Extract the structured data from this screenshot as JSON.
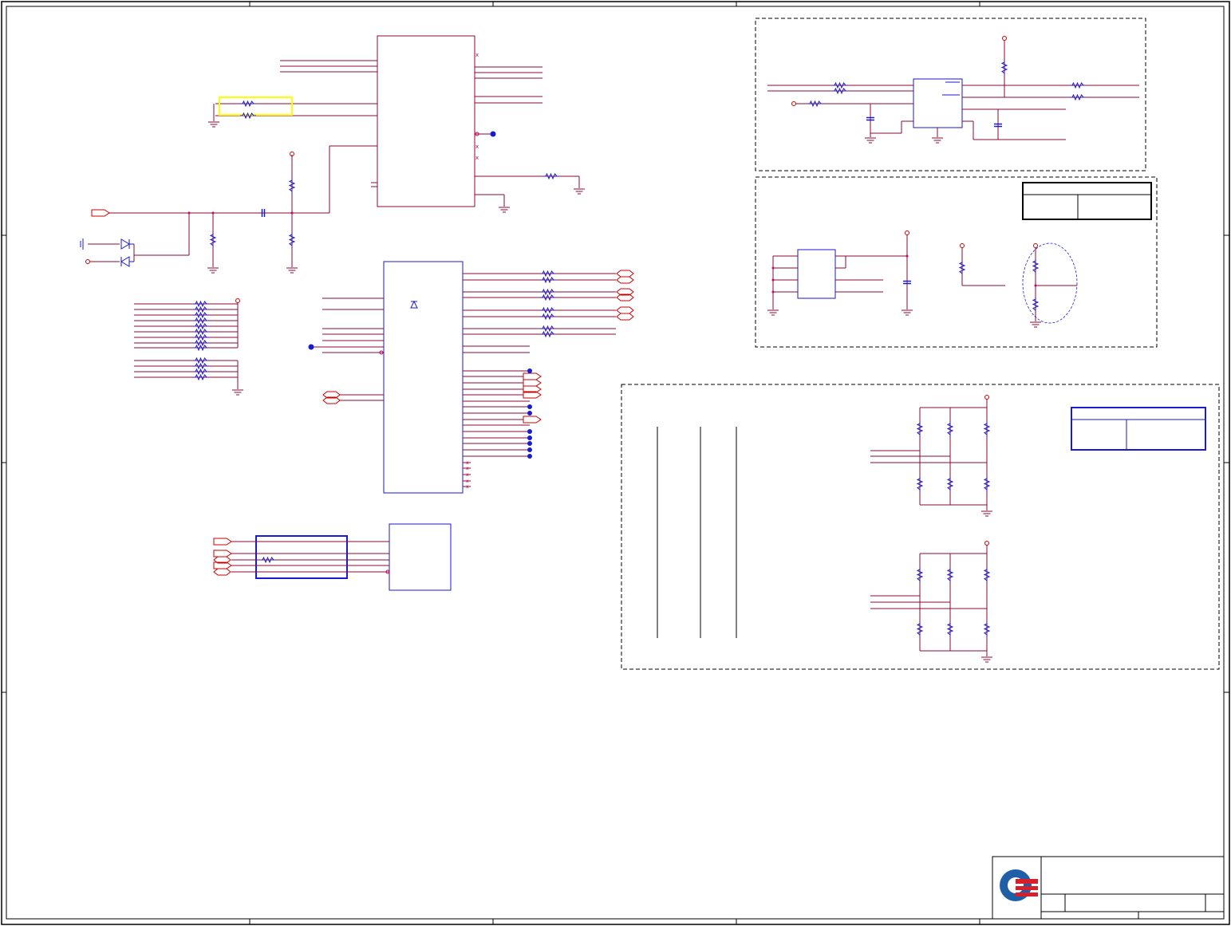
{
  "colors": {
    "frame": "#000000",
    "wire": "#8b0a30",
    "component": "#1a1ad0",
    "pin": "#cc0066",
    "power": "#cc0000",
    "highlight": "#ffff00",
    "logo_blue": "#1f5fa8",
    "logo_red": "#d61f2a"
  },
  "icons": {
    "logo": "company-logo",
    "ground": "ground-symbol",
    "resistor": "resistor-symbol",
    "capacitor": "capacitor-symbol",
    "diode": "diode-symbol",
    "connector": "off-page-connector"
  }
}
